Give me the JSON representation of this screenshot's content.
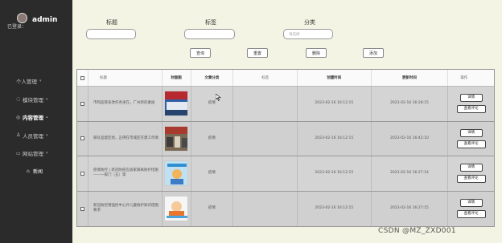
{
  "sidebar": {
    "username": "admin",
    "logged_in_label": "已登录：",
    "menu": [
      {
        "label": "个人管理",
        "icon": "user-icon",
        "expanded": false
      },
      {
        "label": "模块管理",
        "icon": "module-icon",
        "expanded": false
      },
      {
        "label": "内容管理",
        "icon": "content-icon",
        "expanded": true,
        "active": true
      },
      {
        "label": "人员管理",
        "icon": "people-icon",
        "expanded": false
      },
      {
        "label": "网站管理",
        "icon": "site-icon",
        "expanded": false
      }
    ],
    "submenu": {
      "label": "新闻",
      "icon": "home-icon"
    }
  },
  "filters": {
    "title_label": "标题",
    "title_value": "",
    "tag_label": "标签",
    "tag_value": "",
    "category_label": "分类",
    "category_placeholder": "请选择"
  },
  "buttons": {
    "search": "查询",
    "reset": "重置",
    "delete": "删除",
    "add": "添加"
  },
  "table": {
    "headers": [
      "标题",
      "封面图",
      "文章分类",
      "标签",
      "创建时间",
      "更新时间",
      "操作"
    ],
    "rows": [
      {
        "title": "市和监管多改作务坐在，广州新的素质",
        "category": "疫情",
        "tag": "",
        "created": "2023-02-16 16:12:15",
        "updated": "2023-02-16 16:28:15",
        "thumb": "thumb-conference"
      },
      {
        "title": "部队监督区找，正佛在市城区在建工作情",
        "category": "疫情",
        "tag": "",
        "created": "2023-02-16 16:12:15",
        "updated": "2023-02-16 16:42:10",
        "thumb": "thumb-meeting"
      },
      {
        "title": "疫情防控 | 新冠防疫应居家隔离防护措施——一般门（五）第",
        "category": "疫情",
        "tag": "",
        "created": "2023-02-16 16:12:15",
        "updated": "2023-02-16 16:27:14",
        "thumb": "thumb-cartoon"
      },
      {
        "title": "新冠防控增强民中心外儿童防护知识借图要求",
        "category": "疫情",
        "tag": "",
        "created": "2023-02-16 16:12:15",
        "updated": "2023-02-16 16:27:15",
        "thumb": "thumb-child"
      }
    ],
    "row_detail": "详情",
    "row_comment": "查看评论"
  },
  "watermark": "CSDN @MZ_ZXD001"
}
